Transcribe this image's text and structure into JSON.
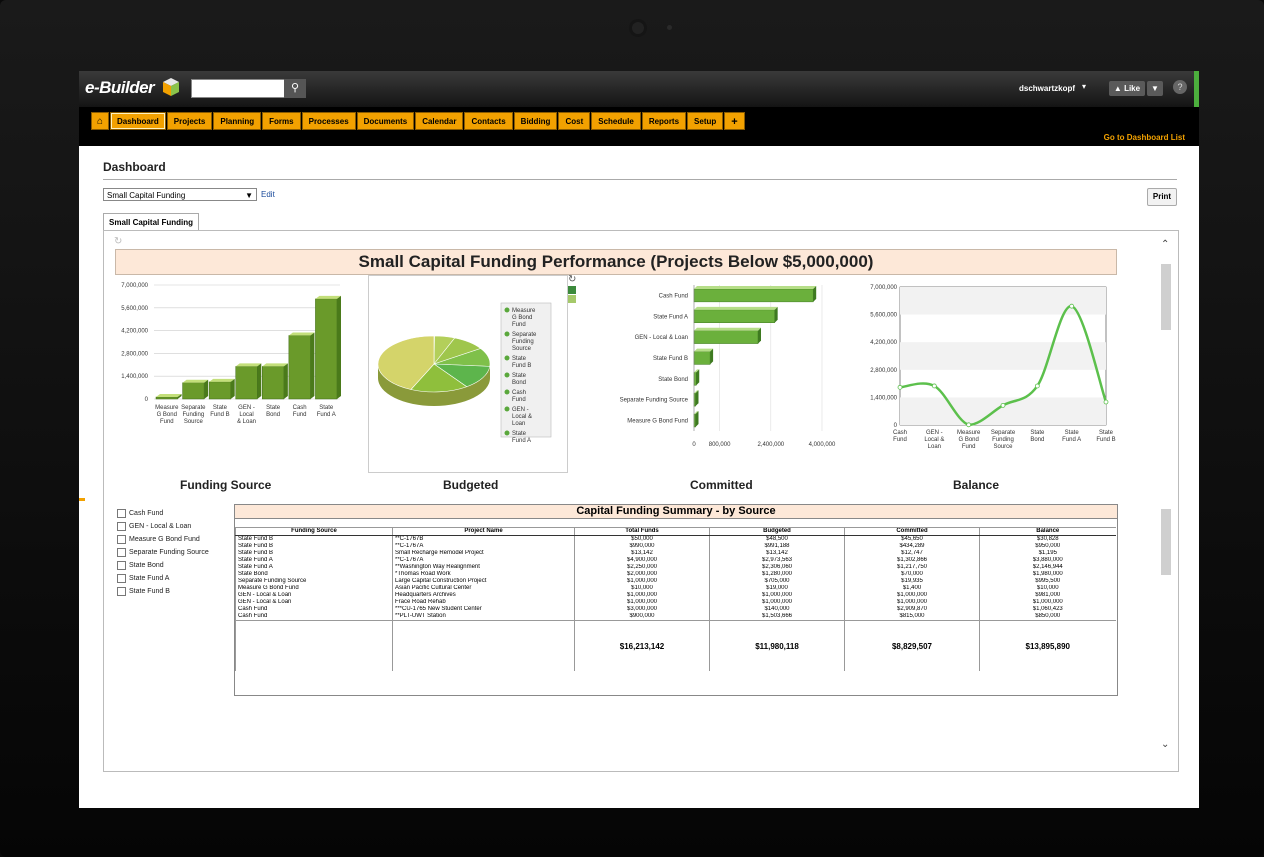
{
  "header": {
    "logo": "e-Builder",
    "user": "dschwartzkopf",
    "like_label": "Like",
    "help_label": "?"
  },
  "nav": {
    "tabs": [
      "Dashboard",
      "Projects",
      "Planning",
      "Forms",
      "Processes",
      "Documents",
      "Calendar",
      "Contacts",
      "Bidding",
      "Cost",
      "Schedule",
      "Reports",
      "Setup"
    ],
    "add_label": "+",
    "dashboard_list_link": "Go to Dashboard List"
  },
  "page": {
    "title": "Dashboard",
    "selected_dashboard": "Small Capital Funding",
    "edit_label": "Edit",
    "print_label": "Print",
    "tab_label": "Small Capital Funding",
    "performance_title": "Small Capital Funding Performance (Projects Below $5,000,000)",
    "column_headers": [
      "Funding Source",
      "Budgeted",
      "Committed",
      "Balance"
    ]
  },
  "chart_data": [
    {
      "type": "bar",
      "categories": [
        "Measure G Bond Fund",
        "Separate Funding Source",
        "State Fund B",
        "GEN - Local & Loan",
        "State Bond",
        "Cash Fund",
        "State Fund A"
      ],
      "values": [
        10000,
        1000000,
        1053142,
        2000000,
        2000000,
        3900000,
        6150000
      ],
      "ylim": [
        0,
        7000000
      ],
      "yticks": [
        "0",
        "1,400,000",
        "2,800,000",
        "4,200,000",
        "5,600,000",
        "7,000,000"
      ]
    },
    {
      "type": "pie",
      "legend": [
        "Measure G Bond Fund",
        "Separate Funding Source",
        "State Fund B",
        "State Bond",
        "Cash Fund",
        "GEN - Local & Loan",
        "State Fund A"
      ],
      "values": [
        19000,
        705000,
        1152830,
        1280000,
        1643666,
        2000000,
        5179623
      ]
    },
    {
      "type": "bar",
      "orientation": "horizontal",
      "categories": [
        "Cash Fund",
        "State Fund A",
        "GEN - Local & Loan",
        "State Fund B",
        "State Bond",
        "Separate Funding Source",
        "Measure G Bond Fund"
      ],
      "values": [
        3724870,
        2520616,
        2000000,
        503097,
        70000,
        19935,
        1400
      ],
      "xlim": [
        0,
        4000000
      ],
      "xticks": [
        "0",
        "800,000",
        "2,400,000",
        "4,000,000"
      ]
    },
    {
      "type": "line",
      "categories": [
        "Cash Fund",
        "GEN - Local & Loan",
        "Measure G Bond Fund",
        "Separate Funding Source",
        "State Bond",
        "State Fund A",
        "State Fund B"
      ],
      "values": [
        1910423,
        1981000,
        10000,
        995500,
        1980000,
        6026944,
        1165000
      ],
      "ylim": [
        0,
        7000000
      ],
      "yticks": [
        "0",
        "1,400,000",
        "2,800,000",
        "4,200,000",
        "5,600,000",
        "7,000,000"
      ]
    }
  ],
  "filters": [
    "Cash Fund",
    "GEN - Local & Loan",
    "Measure G Bond Fund",
    "Separate Funding Source",
    "State Bond",
    "State Fund A",
    "State Fund B"
  ],
  "summary": {
    "title": "Capital Funding Summary - by Source",
    "columns": [
      "Funding Source",
      "Project Name",
      "Total Funds",
      "Budgeted",
      "Committed",
      "Balance"
    ],
    "rows": [
      [
        "State Fund B",
        "**C-1767B",
        "$50,000",
        "$48,500",
        "$45,650",
        "$30,828"
      ],
      [
        "State Fund B",
        "**C-1767A",
        "$990,000",
        "$991,188",
        "$434,289",
        "$950,000"
      ],
      [
        "State Fund B",
        "Small Recharge Remodel Project",
        "$13,142",
        "$13,142",
        "$12,747",
        "$1,195"
      ],
      [
        "State Fund A",
        "**C-1767A",
        "$4,900,000",
        "$2,973,563",
        "$1,302,866",
        "$3,880,000"
      ],
      [
        "State Fund A",
        "**Washington Way Realignment",
        "$2,250,000",
        "$2,306,060",
        "$1,217,750",
        "$2,146,944"
      ],
      [
        "State Bond",
        "*Thomas Road Work",
        "$2,000,000",
        "$1,280,000",
        "$70,000",
        "$1,980,000"
      ],
      [
        "Separate Funding Source",
        "Large Capital Construction Project",
        "$1,000,000",
        "$705,000",
        "$19,935",
        "$995,500"
      ],
      [
        "Measure G Bond Fund",
        "Asian Pacific Cultural Center",
        "$10,000",
        "$19,000",
        "$1,400",
        "$10,000"
      ],
      [
        "GEN - Local & Loan",
        "Headquarters Archives",
        "$1,000,000",
        "$1,000,000",
        "$1,000,000",
        "$981,000"
      ],
      [
        "GEN - Local & Loan",
        "Frace Road Rehab",
        "$1,000,000",
        "$1,000,000",
        "$1,000,000",
        "$1,000,000"
      ],
      [
        "Cash Fund",
        "***CU-1765 New Student Center",
        "$3,000,000",
        "$140,000",
        "$2,909,870",
        "$1,060,423"
      ],
      [
        "Cash Fund",
        "**PLT-UWT Station",
        "$900,000",
        "$1,503,666",
        "$815,000",
        "$850,000"
      ]
    ],
    "totals": [
      "$16,213,142",
      "$11,980,118",
      "$8,829,507",
      "$13,895,890"
    ]
  }
}
